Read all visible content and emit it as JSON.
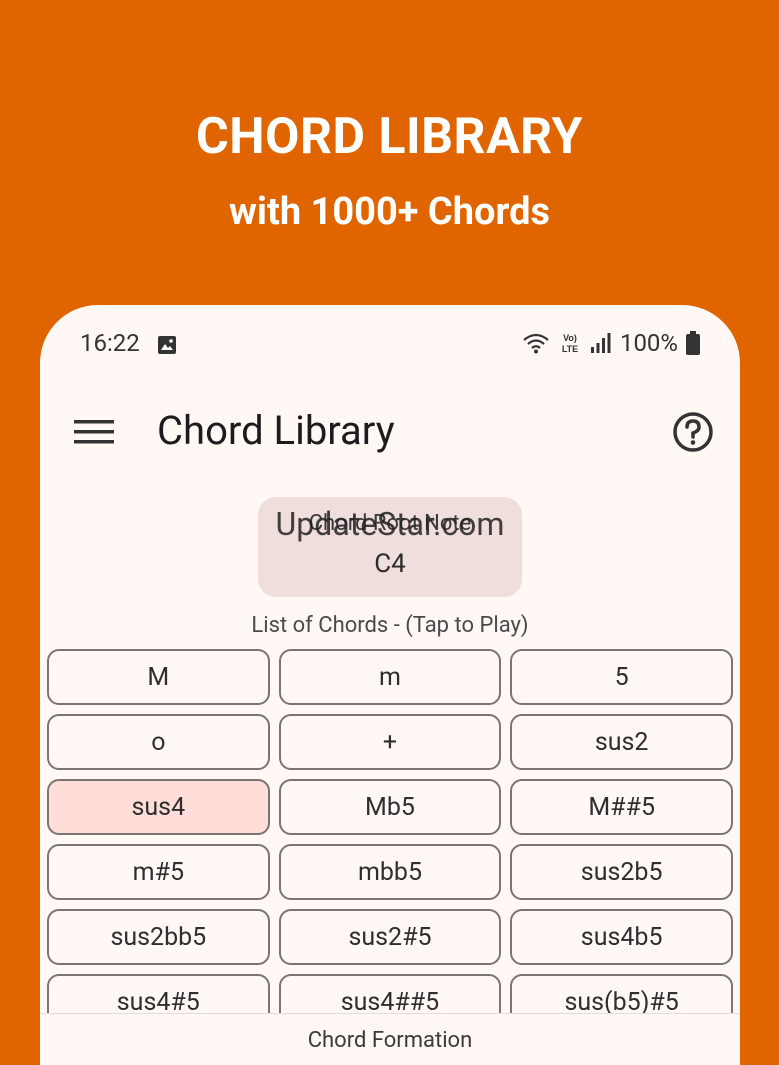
{
  "promo": {
    "title": "CHORD LIBRARY",
    "subtitle": "with 1000+ Chords"
  },
  "status_bar": {
    "time": "16:22",
    "battery": "100%",
    "icons": [
      "image-icon",
      "wifi-icon",
      "volte-icon",
      "signal-icon",
      "battery-icon"
    ],
    "volte_label": "Vo) LTE"
  },
  "app_bar": {
    "title": "Chord Library",
    "menu_icon": "menu-icon",
    "help_icon": "help-icon"
  },
  "root_note": {
    "label": "Chord Root Note",
    "value": "C4"
  },
  "watermark": "UpdateStar.com",
  "chords": {
    "heading": "List of Chords - (Tap to Play)",
    "items": [
      "M",
      "m",
      "5",
      "o",
      "+",
      "sus2",
      "sus4",
      "Mb5",
      "M##5",
      "m#5",
      "mbb5",
      "sus2b5",
      "sus2bb5",
      "sus2#5",
      "sus4b5",
      "sus4#5",
      "sus4##5",
      "sus(b5)#5"
    ],
    "selected": "sus4"
  },
  "bottom": {
    "label": "Chord Formation"
  },
  "colors": {
    "background": "#E06400",
    "surface": "#FFF8F4",
    "selected": "#FFDDD8",
    "root_note_bg": "#F0DEDC"
  }
}
